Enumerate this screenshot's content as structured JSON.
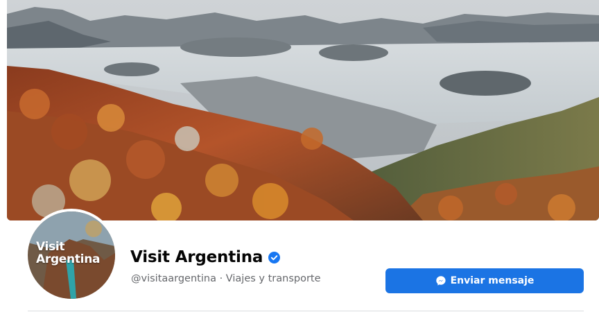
{
  "page": {
    "name": "Visit Argentina",
    "handle_line": "@visitaargentina · Viajes y transporte",
    "verified": true,
    "avatar_lines": [
      "Visit",
      "Argentina"
    ]
  },
  "actions": {
    "message_label": "Enviar mensaje"
  },
  "colors": {
    "accent": "#1b74e4",
    "verified_badge": "#1877f2",
    "secondary_text": "#65676b"
  },
  "icons": {
    "verified": "verified-check-icon",
    "message": "messenger-icon"
  }
}
